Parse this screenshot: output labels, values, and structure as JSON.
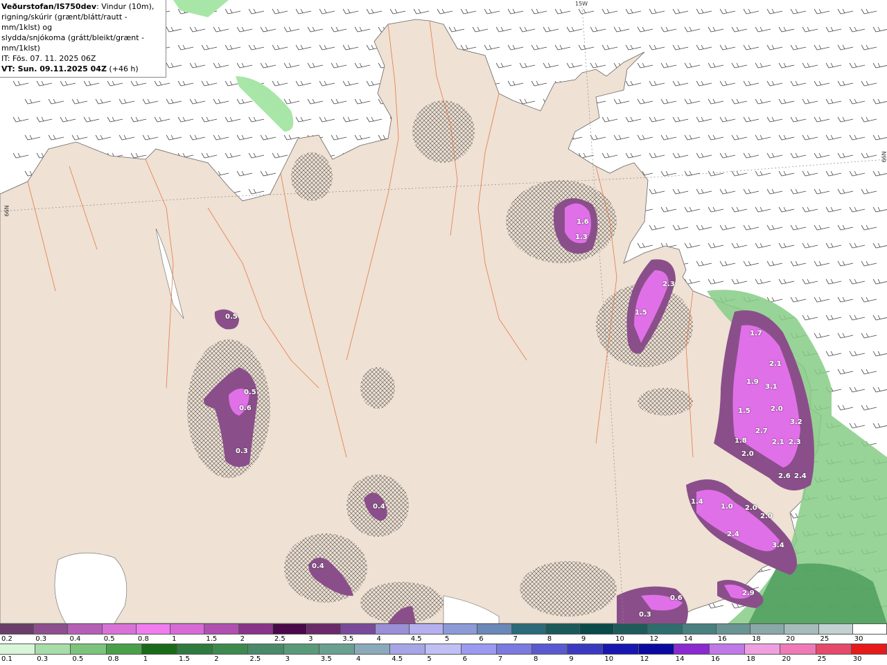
{
  "header": {
    "brand": "Veðurstofan/IS750dev",
    "line1_rest": ": Vindur (10m),",
    "line2": "rigning/skúrir (grænt/blátt/rautt - mm/1klst) og",
    "line3": "slydda/snjókoma (grátt/bleikt/grænt - mm/1klst)",
    "it_line": "IT: Fös. 07. 11. 2025 06Z",
    "vt_line_bold": "VT: Sun. 09.11.2025 04Z",
    "vt_offset": " (+46 h)"
  },
  "grid_labels": {
    "lon": "15W",
    "lat_left": "66N",
    "lat_right": "66N"
  },
  "precip_values": [
    {
      "label": "0.5"
    },
    {
      "label": "1.6"
    },
    {
      "label": "1.3"
    },
    {
      "label": "2.3"
    },
    {
      "label": "1.5"
    },
    {
      "label": "0.5"
    },
    {
      "label": "0.6"
    },
    {
      "label": "0.3"
    },
    {
      "label": "0.4"
    },
    {
      "label": "0.4"
    },
    {
      "label": "1.7"
    },
    {
      "label": "2.1"
    },
    {
      "label": "1.9"
    },
    {
      "label": "3.1"
    },
    {
      "label": "1.5"
    },
    {
      "label": "2.0"
    },
    {
      "label": "3.2"
    },
    {
      "label": "2.7"
    },
    {
      "label": "1.8"
    },
    {
      "label": "2.1"
    },
    {
      "label": "2.3"
    },
    {
      "label": "2.0"
    },
    {
      "label": "2.6"
    },
    {
      "label": "2.4"
    },
    {
      "label": "1.4"
    },
    {
      "label": "1.0"
    },
    {
      "label": "2.0"
    },
    {
      "label": "2.0"
    },
    {
      "label": "2.4"
    },
    {
      "label": "3.4"
    },
    {
      "label": "2.9"
    },
    {
      "label": "0.6"
    },
    {
      "label": "0.3"
    }
  ],
  "legend_snow": {
    "labels": [
      "0.2",
      "0.3",
      "0.4",
      "0.5",
      "0.8",
      "1",
      "1.5",
      "2",
      "2.5",
      "3",
      "3.5",
      "4",
      "4.5",
      "5",
      "6",
      "7",
      "8",
      "9",
      "10",
      "12",
      "14",
      "16",
      "18",
      "20",
      "25",
      "30"
    ],
    "colors": [
      "#6a3e6a",
      "#8e4f8e",
      "#b65fb6",
      "#d872d8",
      "#f07cf0",
      "#d86ad8",
      "#b04fb0",
      "#8a338a",
      "#4a0a4a",
      "#6a2a6a",
      "#7a4a9a",
      "#9b8fd8",
      "#b6b0f0",
      "#8c9ad8",
      "#6a88b8",
      "#2a6a7a",
      "#1a5a5a",
      "#0a4a4a",
      "#1e5c5c",
      "#2e6e6e",
      "#4a8080",
      "#6a9494",
      "#8aa8a8",
      "#a6bcbc",
      "#c2d2d2",
      "#ffffff"
    ]
  },
  "legend_rain": {
    "labels": [
      "0.1",
      "0.3",
      "0.5",
      "0.8",
      "1",
      "1.5",
      "2",
      "2.5",
      "3",
      "3.5",
      "4",
      "4.5",
      "5",
      "6",
      "7",
      "8",
      "9",
      "10",
      "12",
      "14",
      "16",
      "18",
      "20",
      "25",
      "30"
    ],
    "colors": [
      "#d8f5d8",
      "#a8dca8",
      "#7cc47c",
      "#4aa04a",
      "#1a6a1a",
      "#2f7a3f",
      "#3e8a4e",
      "#4a8a6a",
      "#5a9a7a",
      "#6aa090",
      "#8aaabb",
      "#a6a6e6",
      "#c0c0f5",
      "#9a9af0",
      "#7a7ae0",
      "#5a5ad0",
      "#3a3ac0",
      "#1818b0",
      "#0a0aa0",
      "#8a2ad0",
      "#c07ae8",
      "#f0a0e0",
      "#f07ab8",
      "#e64a6a",
      "#e61a1a"
    ]
  },
  "colors": {
    "land": "#efe1d3",
    "sea": "#ffffff",
    "snow_light": "#8a4f8a",
    "snow_strong": "#e070e8",
    "rain_green": "#7ec47e",
    "rain_dark": "#2a6a3a",
    "roads": "#e6784a"
  }
}
